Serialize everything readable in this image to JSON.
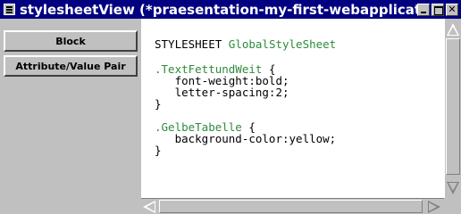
{
  "window": {
    "title": "stylesheetView (*praesentation-my-first-webapplication.gui.xmi)"
  },
  "sidebar": {
    "buttons": [
      {
        "label": "Block"
      },
      {
        "label": "Attribute/Value Pair"
      }
    ]
  },
  "editor": {
    "lines": [
      {
        "parts": [
          "STYLESHEET ",
          "GlobalStyleSheet"
        ]
      },
      {
        "parts": [
          ".TextFettundWeit",
          " {"
        ]
      },
      {
        "parts": [
          "   font-weight:bold;"
        ]
      },
      {
        "parts": [
          "   letter-spacing:2;"
        ]
      },
      {
        "parts": [
          "}"
        ]
      },
      {
        "parts": [
          ".GelbeTabelle",
          " {"
        ]
      },
      {
        "parts": [
          "   background-color:yellow;"
        ]
      },
      {
        "parts": [
          "}"
        ]
      }
    ]
  },
  "colors": {
    "titlebar": "#000080",
    "selector_green": "#2e8b3a",
    "panel_gray": "#c0c0c0"
  }
}
